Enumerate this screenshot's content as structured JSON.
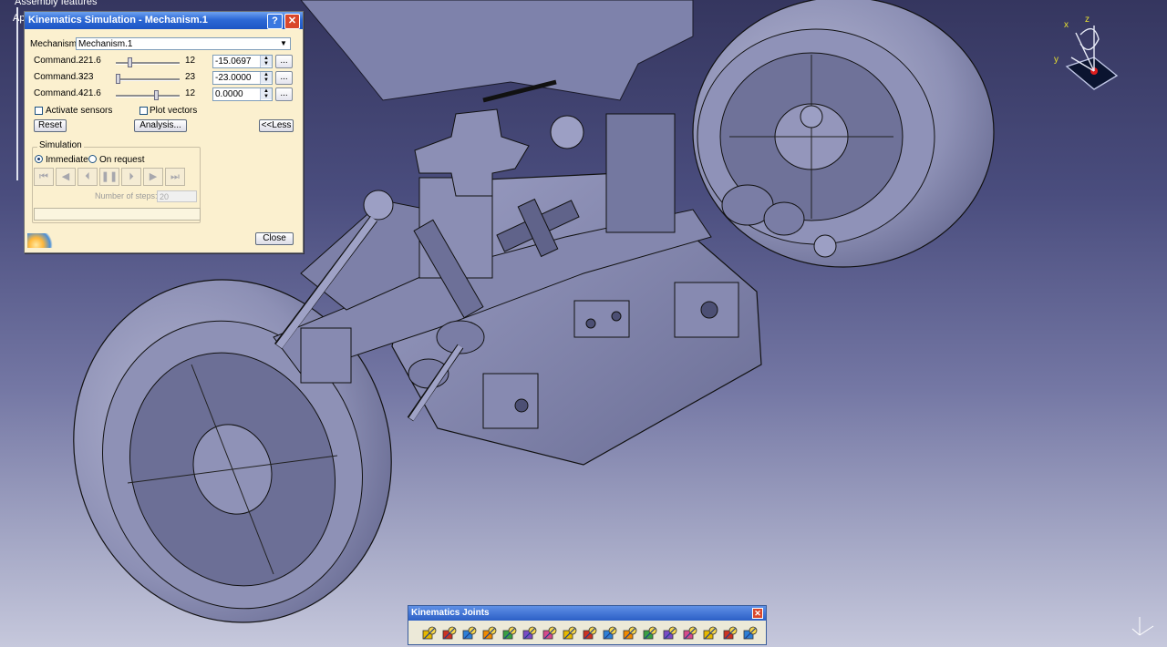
{
  "tree": {
    "label": "Assembly features",
    "partial_label": "Ap"
  },
  "dialog": {
    "title": "Kinematics Simulation - Mechanism.1",
    "help_label": "?",
    "close_x_label": "✕",
    "mechanism_label": "Mechanism:",
    "mechanism_value": "Mechanism.1",
    "commands": [
      {
        "name": "Command.2",
        "min": "-21.6",
        "max": "12",
        "value": "-15.0697",
        "slider_fraction": 0.2
      },
      {
        "name": "Command.3",
        "min": "-23",
        "max": "23",
        "value": "-23.0000",
        "slider_fraction": 0.0
      },
      {
        "name": "Command.4",
        "min": "-21.6",
        "max": "12",
        "value": "0.0000",
        "slider_fraction": 0.64
      }
    ],
    "more_label": "...",
    "activate_sensors_label": "Activate sensors",
    "activate_sensors_checked": false,
    "plot_vectors_label": "Plot vectors",
    "plot_vectors_checked": false,
    "reset_label": "Reset",
    "analysis_label": "Analysis...",
    "less_label": "<<Less",
    "simulation_group_label": "Simulation",
    "immediate_label": "Immediate",
    "on_request_label": "On request",
    "immediate_selected": true,
    "playback": [
      "skip-to-start-icon",
      "step-back-icon",
      "play-backward-icon",
      "pause-icon",
      "play-forward-icon",
      "step-forward-icon",
      "skip-to-end-icon"
    ],
    "steps_label": "Number of steps:",
    "steps_value": "20",
    "close_label": "Close"
  },
  "compass": {
    "x": "x",
    "y": "y",
    "z": "z"
  },
  "toolbar": {
    "title": "Kinematics Joints",
    "close_label": "✕",
    "tools": [
      "revolute-joint-icon",
      "prismatic-joint-icon",
      "cylindrical-joint-icon",
      "screw-joint-icon",
      "sphere-joint-icon",
      "planar-joint-icon",
      "rigid-joint-icon",
      "point-curve-joint-icon",
      "slide-curve-joint-icon",
      "roll-curve-joint-icon",
      "point-surface-joint-icon",
      "universal-joint-icon",
      "cv-joint-icon",
      "gear-joint-icon",
      "rack-joint-icon",
      "cable-joint-icon",
      "axis-joint-icon"
    ]
  },
  "colors": {
    "title_blue": "#2d69d6",
    "dialog_bg": "#fbf0cf",
    "viewport_top": "#35365f",
    "viewport_bottom": "#c6c8dc"
  }
}
